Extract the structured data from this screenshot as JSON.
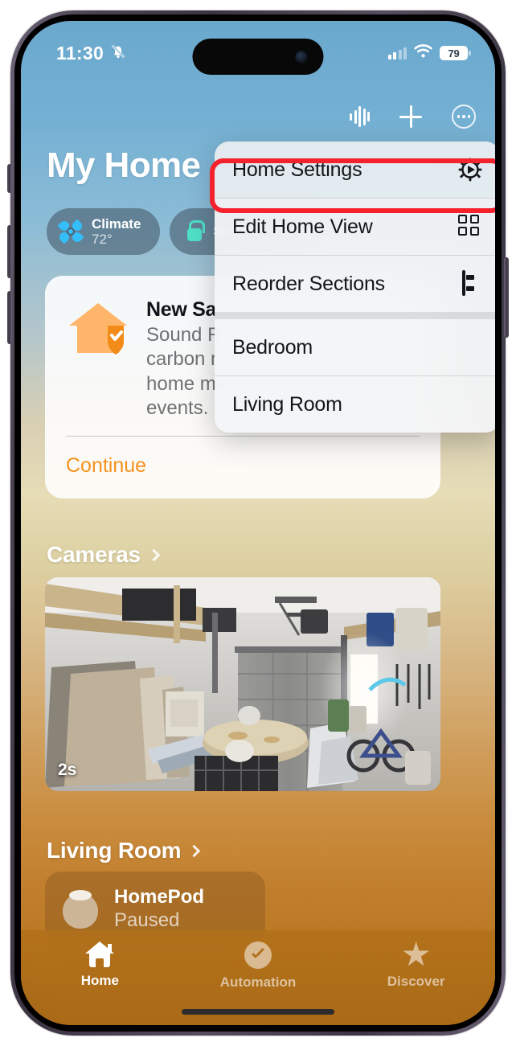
{
  "status_bar": {
    "time": "11:30",
    "mute_icon": "bell-slash-icon",
    "signal_icon": "cellular-signal-icon",
    "wifi_icon": "wifi-icon",
    "battery_level": "79"
  },
  "nav": {
    "waveform_icon": "audio-waveform-icon",
    "add_icon": "plus-icon",
    "more_icon": "ellipsis-circle-icon"
  },
  "home": {
    "title": "My Home",
    "chips": [
      {
        "icon": "fan-icon",
        "title": "Climate",
        "value": "72°",
        "accent": "#34befa"
      },
      {
        "icon": "lock-icon",
        "title": "Security",
        "value": "",
        "accent": "#4fe0c8"
      }
    ],
    "card": {
      "icon": "house-shield-icon",
      "title": "New Sa",
      "body": "Sound R\ncarbon n\nhome me\nevents.",
      "action": "Continue",
      "action_color": "#f5921e"
    },
    "sections": [
      {
        "label": "Cameras",
        "chevron": "chevron-right-icon"
      },
      {
        "label": "Living Room",
        "chevron": "chevron-right-icon"
      }
    ],
    "camera": {
      "timestamp": "2s",
      "name": "garage-camera-feed"
    },
    "accessory": {
      "icon": "homepod-icon",
      "name": "HomePod",
      "state": "Paused"
    }
  },
  "context_menu": {
    "items": [
      {
        "label": "Home Settings",
        "icon": "gear-icon",
        "highlighted": true
      },
      {
        "label": "Edit Home View",
        "icon": "grid-icon",
        "highlighted": false
      },
      {
        "label": "Reorder Sections",
        "icon": "reorder-list-icon",
        "highlighted": false
      },
      {
        "label": "Bedroom",
        "icon": "",
        "highlighted": false
      },
      {
        "label": "Living Room",
        "icon": "",
        "highlighted": false
      }
    ],
    "highlight_color": "#f5222d"
  },
  "tab_bar": {
    "tabs": [
      {
        "label": "Home",
        "icon": "house-icon",
        "active": true
      },
      {
        "label": "Automation",
        "icon": "clock-check-icon",
        "active": false
      },
      {
        "label": "Discover",
        "icon": "star-icon",
        "active": false
      }
    ]
  }
}
